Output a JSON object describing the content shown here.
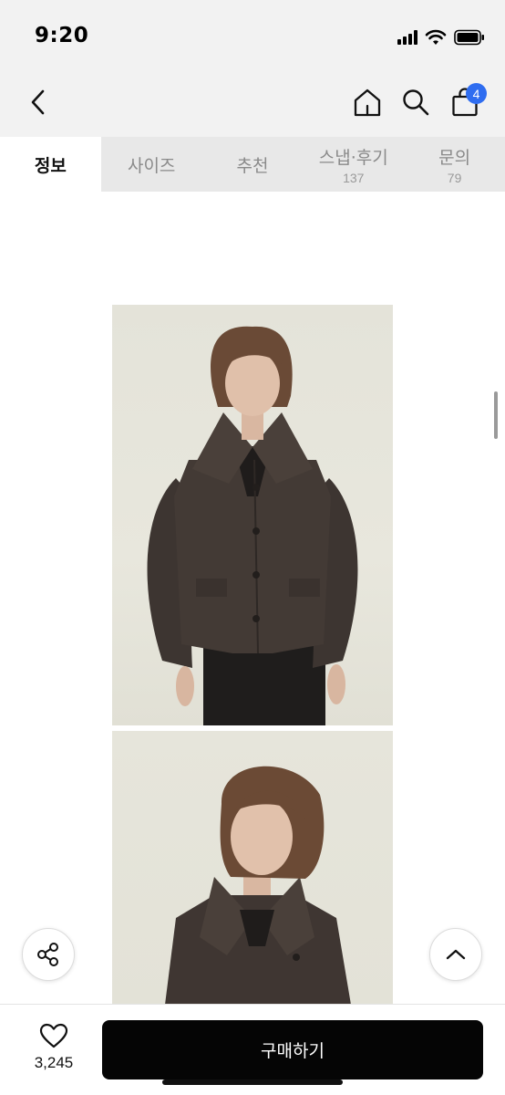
{
  "status_bar": {
    "time": "9:20",
    "icons": [
      "signal-icon",
      "wifi-icon",
      "battery-icon"
    ]
  },
  "nav": {
    "icons": [
      "back-chevron-icon",
      "home-icon",
      "search-icon",
      "shopping-bag-icon"
    ],
    "cart_badge": "4",
    "badge_color": "#2f6df0"
  },
  "tabs": [
    {
      "label": "정보",
      "count": "",
      "active": true
    },
    {
      "label": "사이즈",
      "count": "",
      "active": false
    },
    {
      "label": "추천",
      "count": "",
      "active": false
    },
    {
      "label": "스냅·후기",
      "count": "137",
      "active": false
    },
    {
      "label": "문의",
      "count": "79",
      "active": false
    }
  ],
  "content": {
    "images": [
      "product-photo-front-jacket",
      "product-photo-portrait-jacket"
    ]
  },
  "floating": {
    "icons": [
      "share-icon",
      "scroll-to-top-icon"
    ]
  },
  "bottom": {
    "like_count": "3,245",
    "buy_label": "구매하기",
    "buy_color": "#050505"
  }
}
